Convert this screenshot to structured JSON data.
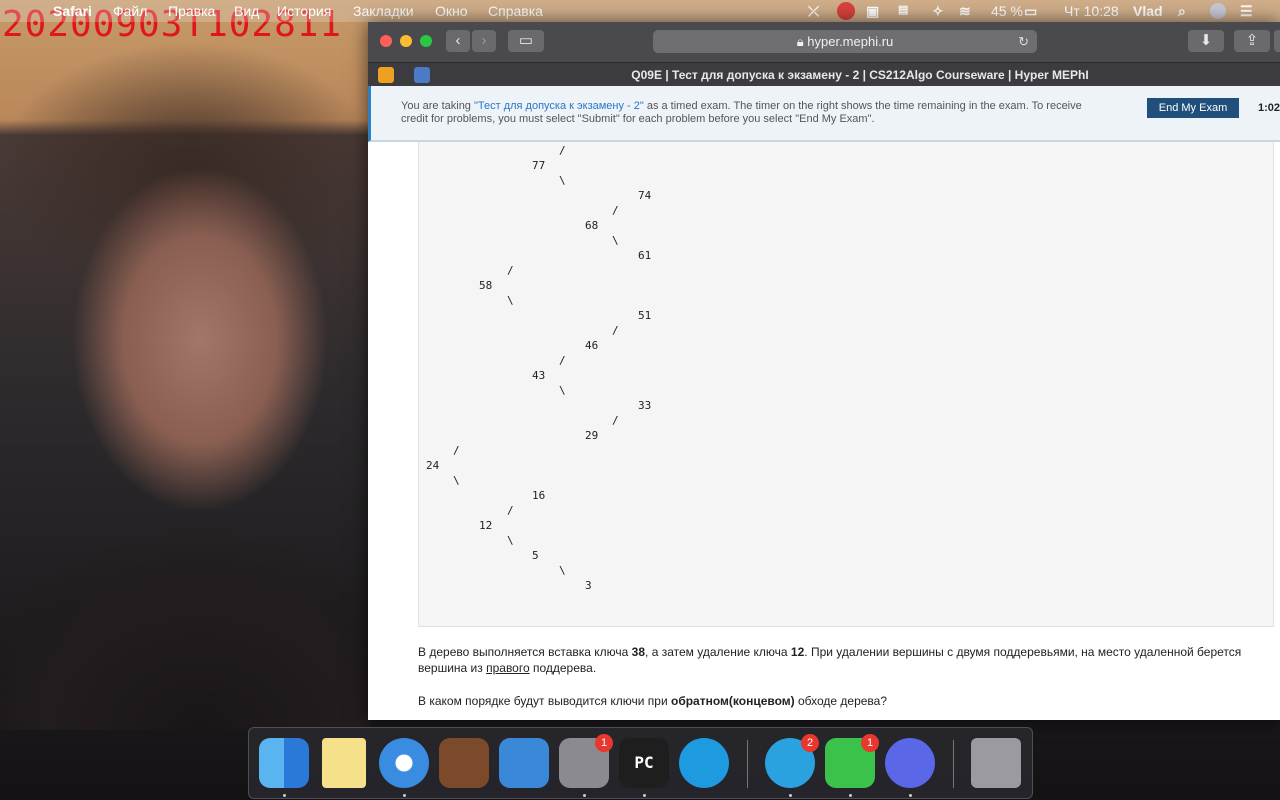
{
  "cam_timestamp": "20200903T102811",
  "menubar": {
    "apple": "",
    "app": "Safari",
    "items": [
      "Файл",
      "Правка",
      "Вид",
      "История",
      "Закладки",
      "Окно",
      "Справка"
    ],
    "battery": "45 %",
    "clock": "Чт 10:28",
    "user": "Vlad"
  },
  "browser": {
    "url": "hyper.mephi.ru",
    "tab_title": "Q09E | Тест для допуска к экзамену - 2 | CS212Algo Courseware | Hyper MEPhI"
  },
  "banner": {
    "text_before": "You are taking ",
    "exam_link": "\"Тест для допуска к экзамену - 2\"",
    "text_after": " as a timed exam. The timer on the right shows the time remaining in the exam. To receive credit for problems, you must select \"Submit\" for each problem before you select \"End My Exam\".",
    "end_button": "End My Exam",
    "timer": "1:02:"
  },
  "tree_lines": [
    {
      "t": "/"
    },
    {
      "t": "77"
    },
    {
      "t": "\\"
    },
    {
      "t": "74"
    },
    {
      "t": "/"
    },
    {
      "t": "68"
    },
    {
      "t": "\\"
    },
    {
      "t": "61"
    },
    {
      "t": "/"
    },
    {
      "t": "58"
    },
    {
      "t": "\\"
    },
    {
      "t": "51"
    },
    {
      "t": "/"
    },
    {
      "t": "46"
    },
    {
      "t": "/"
    },
    {
      "t": "43"
    },
    {
      "t": "\\"
    },
    {
      "t": "33"
    },
    {
      "t": "/"
    },
    {
      "t": "29"
    },
    {
      "t": "/"
    },
    {
      "t": "24"
    },
    {
      "t": "\\"
    },
    {
      "t": "16"
    },
    {
      "t": "/"
    },
    {
      "t": "12"
    },
    {
      "t": "\\"
    },
    {
      "t": "5"
    },
    {
      "t": "\\"
    },
    {
      "t": "3"
    }
  ],
  "question": {
    "p1_a": "В дерево выполняется вставка ключа ",
    "p1_key1": "38",
    "p1_b": ", а затем удаление ключа ",
    "p1_key2": "12",
    "p1_c": ". При удалении вершины с двумя поддеревьями, на место удаленной берется вершина из ",
    "p1_right": "правого",
    "p1_d": " поддерева.",
    "p2_a": "В каком порядке будут выводится ключи при ",
    "p2_bold": "обратном(концевом)",
    "p2_b": " обходе дерева?"
  },
  "dock": {
    "badges": {
      "preferences": "1",
      "telegram": "2",
      "messages": "1"
    },
    "pycharm_label": "PC"
  }
}
